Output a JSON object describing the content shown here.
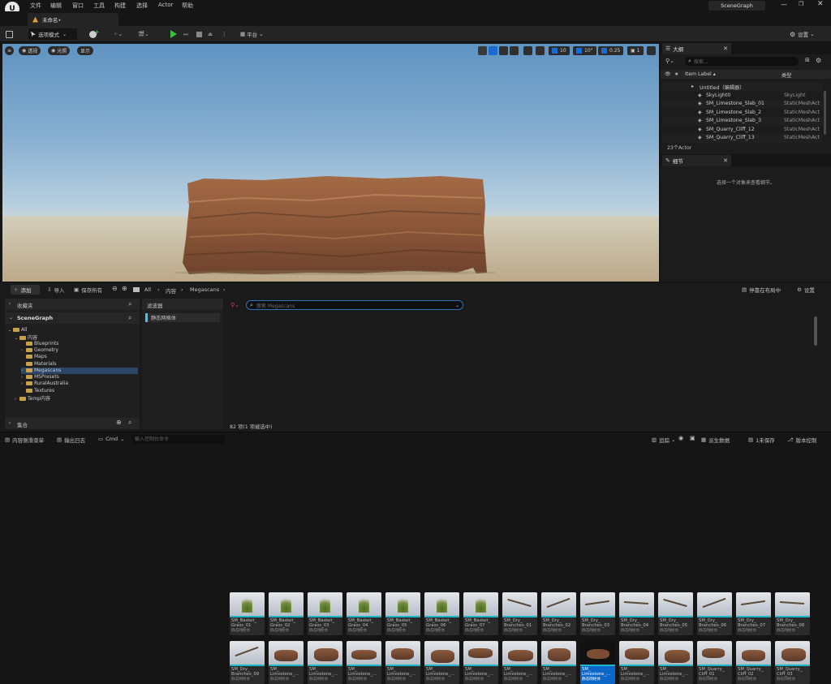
{
  "app": {
    "menu": [
      "文件",
      "编辑",
      "窗口",
      "工具",
      "构建",
      "选择",
      "Actor",
      "帮助"
    ],
    "project_name": "SceneGraph",
    "level_tab": "未命名•"
  },
  "toolbar": {
    "mode": "选项模式",
    "platform": "平台",
    "settings": "设置"
  },
  "viewport": {
    "perspective": "透视",
    "lit": "光照",
    "show": "显示",
    "grid_snap": "10",
    "rot_snap": "10°",
    "scale_snap": "0.25",
    "cam_speed": "1"
  },
  "outliner": {
    "title": "大纲",
    "search_placeholder": "搜索...",
    "col_label": "Item Label ▴",
    "col_type": "类型",
    "rows": [
      {
        "label": "Untitled（编辑器）",
        "type": ""
      },
      {
        "label": "SkyLight0",
        "type": "SkyLight"
      },
      {
        "label": "SM_Limestone_Slab_01",
        "type": "StaticMeshAct"
      },
      {
        "label": "SM_Limestone_Slab_2",
        "type": "StaticMeshAct"
      },
      {
        "label": "SM_Limestone_Slab_3",
        "type": "StaticMeshAct"
      },
      {
        "label": "SM_Quarry_Cliff_12",
        "type": "StaticMeshAct"
      },
      {
        "label": "SM_Quarry_Cliff_13",
        "type": "StaticMeshAct"
      }
    ],
    "count": "23个Actor"
  },
  "details": {
    "title": "细节",
    "empty_msg": "选择一个对象来查看细节。"
  },
  "content_browser": {
    "add": "添加",
    "import": "导入",
    "save_all": "保存所有",
    "path": [
      "All",
      "内容",
      "Megascans"
    ],
    "dock_in_layout": "停靠在布局中",
    "settings": "设置",
    "favorites": "收藏夹",
    "project": "SceneGraph",
    "tree": [
      {
        "label": "All",
        "depth": 0
      },
      {
        "label": "内容",
        "depth": 1
      },
      {
        "label": "Blueprints",
        "depth": 2
      },
      {
        "label": "Geometry",
        "depth": 2
      },
      {
        "label": "Maps",
        "depth": 2
      },
      {
        "label": "Materials",
        "depth": 2
      },
      {
        "label": "Megascans",
        "depth": 2
      },
      {
        "label": "MSPresets",
        "depth": 2
      },
      {
        "label": "RuralAustralia",
        "depth": 2
      },
      {
        "label": "Textures",
        "depth": 2
      },
      {
        "label": "Temp内容",
        "depth": 1
      }
    ],
    "collections": "集合",
    "filters": "滤波器",
    "filter_item": "静态网格体",
    "search_placeholder": "搜索 Megascans",
    "asset_type": "静态网格体",
    "assets_row1": [
      "SM_Basket_Grass_01",
      "SM_Basket_Grass_02",
      "SM_Basket_Grass_03",
      "SM_Basket_Grass_04",
      "SM_Basket_Grass_05",
      "SM_Basket_Grass_06",
      "SM_Basket_Grass_07",
      "SM_Dry_Branches_01",
      "SM_Dry_Branches_02",
      "SM_Dry_Branches_03",
      "SM_Dry_Branches_04",
      "SM_Dry_Branches_05",
      "SM_Dry_Branches_06",
      "SM_Dry_Branches_07",
      "SM_Dry_Branches_08"
    ],
    "assets_row1_labels": [
      "SM_Basket_ Grass_01",
      "SM_Basket_ Grass_02",
      "SM_Basket_ Grass_03",
      "SM_Basket_ Grass_04",
      "SM_Basket_ Grass_05",
      "SM_Basket_ Grass_06",
      "SM_Basket_ Grass_07",
      "SM_Dry_ Branches_01",
      "SM_Dry_ Branches_02",
      "SM_Dry_ Branches_03",
      "SM_Dry_ Branches_04",
      "SM_Dry_ Branches_05",
      "SM_Dry_ Branches_06",
      "SM_Dry_ Branches_07",
      "SM_Dry_ Branches_08"
    ],
    "assets_row2_labels": [
      "SM_Dry_ Branches_09",
      "SM_ Limestone_...",
      "SM_ Limestone_...",
      "SM_ Limestone_...",
      "SM_ Limestone_...",
      "SM_ Limestone_...",
      "SM_ Limestone_...",
      "SM_ Limestone_...",
      "SM_ Limestone_...",
      "SM_ Limestone_...",
      "SM_ Limestone_...",
      "SM_ Limestone_...",
      "SM_Quarry_ Cliff_01",
      "SM_Quarry_ Cliff_02",
      "SM_Quarry_ Cliff_03"
    ],
    "status": "82 项(1 项被选中)"
  },
  "statusbar": {
    "drawer": "内容侧滑菜单",
    "output_log": "输出日志",
    "cmd": "Cmd",
    "cmd_placeholder": "输入控制台命令",
    "trace": "追踪",
    "derived_data": "派生数据",
    "unsaved": "1未保存",
    "source_control": "版本控制"
  }
}
